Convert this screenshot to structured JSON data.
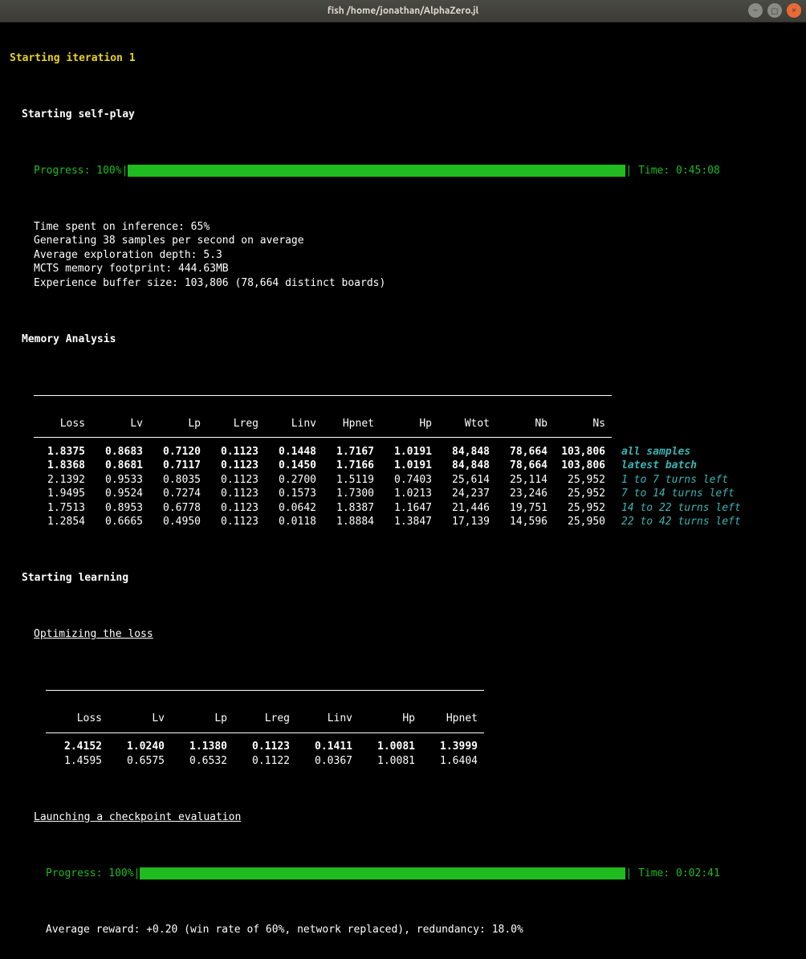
{
  "window": {
    "title": "fish  /home/jonathan/AlphaZero.jl"
  },
  "iteration_header": "Starting iteration 1",
  "selfplay": {
    "header": "Starting self-play",
    "progress_label": "Progress: 100%",
    "time_label": "Time: 0:45:08",
    "stats": [
      "Time spent on inference: 65%",
      "Generating 38 samples per second on average",
      "Average exploration depth: 5.3",
      "MCTS memory footprint: 444.63MB",
      "Experience buffer size: 103,806 (78,664 distinct boards)"
    ]
  },
  "memory": {
    "header": "Memory Analysis",
    "cols": [
      "Loss",
      "Lv",
      "Lp",
      "Lreg",
      "Linv",
      "Hpnet",
      "Hp",
      "Wtot",
      "Nb",
      "Ns"
    ],
    "rows": [
      {
        "v": [
          "1.8375",
          "0.8683",
          "0.7120",
          "0.1123",
          "0.1448",
          "1.7167",
          "1.0191",
          "84,848",
          "78,664",
          "103,806"
        ],
        "note": "all samples",
        "bold": true
      },
      {
        "v": [
          "1.8368",
          "0.8681",
          "0.7117",
          "0.1123",
          "0.1450",
          "1.7166",
          "1.0191",
          "84,848",
          "78,664",
          "103,806"
        ],
        "note": "latest batch",
        "bold": true
      },
      {
        "v": [
          "2.1392",
          "0.9533",
          "0.8035",
          "0.1123",
          "0.2700",
          "1.5119",
          "0.7403",
          "25,614",
          "25,114",
          "25,952"
        ],
        "note": "1 to 7 turns left",
        "bold": false
      },
      {
        "v": [
          "1.9495",
          "0.9524",
          "0.7274",
          "0.1123",
          "0.1573",
          "1.7300",
          "1.0213",
          "24,237",
          "23,246",
          "25,952"
        ],
        "note": "7 to 14 turns left",
        "bold": false
      },
      {
        "v": [
          "1.7513",
          "0.8953",
          "0.6778",
          "0.1123",
          "0.0642",
          "1.8387",
          "1.1647",
          "21,446",
          "19,751",
          "25,952"
        ],
        "note": "14 to 22 turns left",
        "bold": false
      },
      {
        "v": [
          "1.2854",
          "0.6665",
          "0.4950",
          "0.1123",
          "0.0118",
          "1.8884",
          "1.3847",
          "17,139",
          "14,596",
          "25,950"
        ],
        "note": "22 to 42 turns left",
        "bold": false
      }
    ]
  },
  "learning": {
    "header": "Starting learning",
    "optimize_header": "Optimizing the loss",
    "cols": [
      "Loss",
      "Lv",
      "Lp",
      "Lreg",
      "Linv",
      "Hp",
      "Hpnet"
    ],
    "rows": [
      {
        "v": [
          "2.4152",
          "1.0240",
          "1.1380",
          "0.1123",
          "0.1411",
          "1.0081",
          "1.3999"
        ],
        "bold": true
      },
      {
        "v": [
          "1.4595",
          "0.6575",
          "0.6532",
          "0.1122",
          "0.0367",
          "1.0081",
          "1.6404"
        ],
        "bold": false
      }
    ],
    "checkpoint_header": "Launching a checkpoint evaluation",
    "progress_label": "Progress: 100%",
    "time_label": "Time: 0:02:41",
    "reward_line": "Average reward: +0.20 (win rate of 60%, network replaced), redundancy: 18.0%"
  }
}
